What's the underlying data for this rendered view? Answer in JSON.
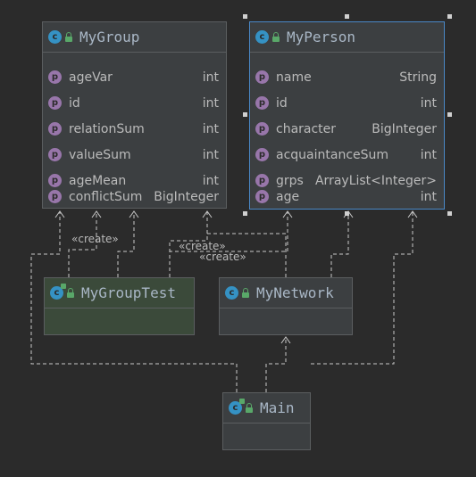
{
  "classes": {
    "mygroup": {
      "name": "MyGroup",
      "icon": "class-icon",
      "fields": [
        {
          "name": "ageVar",
          "type": "int"
        },
        {
          "name": "id",
          "type": "int"
        },
        {
          "name": "relationSum",
          "type": "int"
        },
        {
          "name": "valueSum",
          "type": "int"
        },
        {
          "name": "ageMean",
          "type": "int"
        },
        {
          "name": "conflictSum",
          "type": "BigInteger"
        }
      ]
    },
    "myperson": {
      "name": "MyPerson",
      "icon": "class-icon",
      "selected": true,
      "fields": [
        {
          "name": "name",
          "type": "String"
        },
        {
          "name": "id",
          "type": "int"
        },
        {
          "name": "character",
          "type": "BigInteger"
        },
        {
          "name": "acquaintanceSum",
          "type": "int"
        },
        {
          "name": "grps",
          "type": "ArrayList<Integer>"
        },
        {
          "name": "age",
          "type": "int"
        }
      ]
    },
    "mygrouptest": {
      "name": "MyGroupTest",
      "icon": "test-class-icon"
    },
    "mynetwork": {
      "name": "MyNetwork",
      "icon": "class-icon"
    },
    "main": {
      "name": "Main",
      "icon": "main-class-icon"
    }
  },
  "field_icon_letter": "p",
  "class_icon_letter": "c",
  "labels": {
    "create_1": "«create»",
    "create_2": "«create»",
    "create_3": "«create»"
  },
  "colors": {
    "background": "#2b2b2b",
    "node": "#3c3f41",
    "selected_border": "#4a88c7",
    "test_node": "#3b4a3a",
    "edge": "#c8c8c8"
  }
}
